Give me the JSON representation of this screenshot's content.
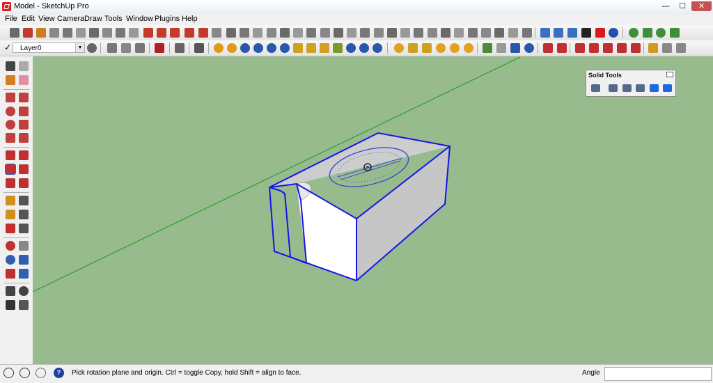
{
  "window": {
    "title": "Model - SketchUp Pro",
    "min": "—",
    "max": "☐",
    "close": "✕"
  },
  "menubar": [
    "File",
    "Edit",
    "View",
    "Camera",
    "Draw",
    "Tools",
    "Window",
    "Plugins",
    "Help"
  ],
  "layers": {
    "check": "✓",
    "current_layer": "Layer0",
    "dropdown": "▼"
  },
  "solid_tools": {
    "title": "Solid Tools"
  },
  "statusbar": {
    "message": "Pick rotation plane and origin.  Ctrl = toggle Copy, hold Shift = align to face.",
    "measurement_label": "Angle",
    "measurement_value": "",
    "question_icon": "?"
  },
  "colors": {
    "viewport_bg": "#98bb8e",
    "selection": "#1515e6",
    "axis_green": "#1a9a1a",
    "box_top": "#cdcdcd",
    "box_front": "#ffffff"
  },
  "icons": {
    "status": [
      "geo-location-icon",
      "credits-icon",
      "user-icon",
      "help-icon"
    ],
    "left_tools": [
      "select-icon",
      "component-icon",
      "paint-bucket-icon",
      "eraser-icon",
      "rectangle-icon",
      "line-icon",
      "circle-icon",
      "freehand-icon",
      "polygon-icon",
      "arc-icon",
      "pie-icon",
      "two-point-arc-icon",
      "move-icon",
      "push-pull-icon",
      "rotate-icon",
      "follow-me-icon",
      "scale-icon",
      "offset-icon",
      "tape-measure-icon",
      "dimension-icon",
      "protractor-icon",
      "text-icon",
      "axes-icon",
      "3d-text-icon",
      "orbit-icon",
      "pan-icon",
      "zoom-icon",
      "zoom-window-icon",
      "zoom-extents-icon",
      "previous-view-icon",
      "position-camera-icon",
      "look-around-icon",
      "walk-icon",
      "section-plane-icon"
    ],
    "solid_tools": [
      "outer-shell-icon",
      "intersect-icon",
      "union-icon",
      "subtract-icon",
      "trim-icon",
      "split-icon"
    ]
  }
}
